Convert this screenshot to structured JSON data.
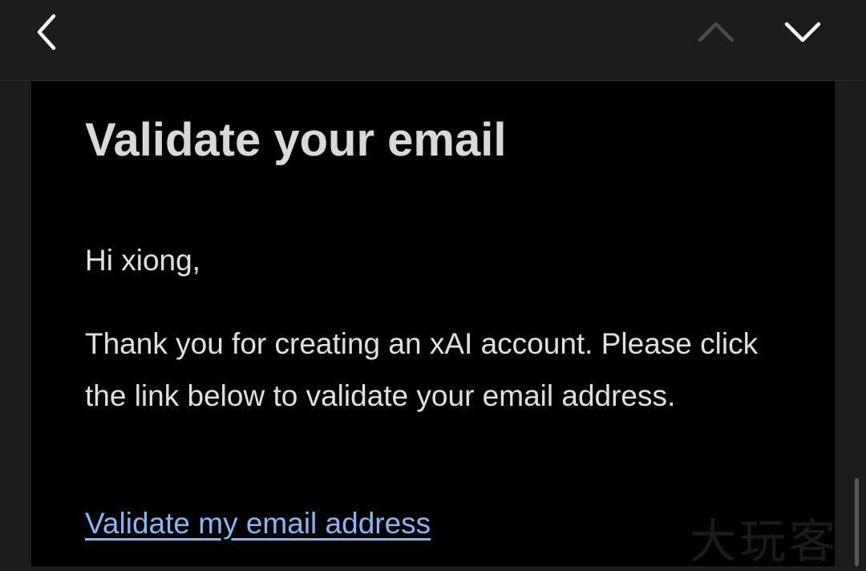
{
  "nav": {
    "back_icon": "chevron-left-icon",
    "prev_icon": "chevron-up-icon",
    "next_icon": "chevron-down-icon"
  },
  "email": {
    "title": "Validate your email",
    "greeting": "Hi xiong,",
    "body": "Thank you for creating an xAI account. Please click the link below to validate your email address.",
    "link_text": "Validate my email address"
  },
  "watermark": "大玩客",
  "colors": {
    "background": "#1c1c1e",
    "email_background": "#000000",
    "title": "#d9d9d9",
    "text": "#e0e0e0",
    "link": "#8ab4f8",
    "disabled_icon": "#4a4a4c"
  }
}
